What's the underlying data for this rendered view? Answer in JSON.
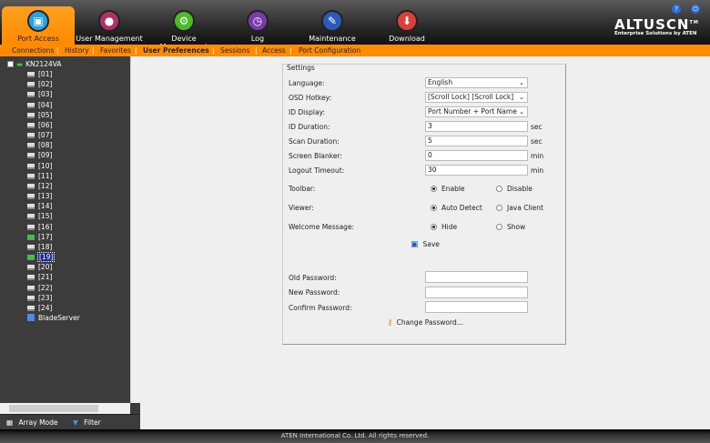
{
  "header": {
    "tabs": [
      {
        "label": "Port Access",
        "icon": "port-access-icon",
        "active": true
      },
      {
        "label": "User Management",
        "icon": "users-icon"
      },
      {
        "label": "Device Management",
        "icon": "device-icon"
      },
      {
        "label": "Log",
        "icon": "log-icon"
      },
      {
        "label": "Maintenance",
        "icon": "maintenance-icon"
      },
      {
        "label": "Download",
        "icon": "download-icon"
      }
    ],
    "logo": "ALTUSCN",
    "logo_tm": "TM",
    "logo_sub": "Enterprise Solutions by ATEN",
    "accent": "#ff8c00"
  },
  "subnav": {
    "items": [
      "Connections",
      "History",
      "Favorites",
      "User Preferences",
      "Sessions",
      "Access",
      "Port Configuration"
    ],
    "active": "User Preferences"
  },
  "sidebar": {
    "root": "KN2124VA",
    "ports": [
      "[01]",
      "[02]",
      "[03]",
      "[04]",
      "[05]",
      "[06]",
      "[07]",
      "[08]",
      "[09]",
      "[10]",
      "[11]",
      "[12]",
      "[13]",
      "[14]",
      "[15]",
      "[16]",
      "[17]",
      "[18]",
      "[19]",
      "[20]",
      "[21]",
      "[22]",
      "[23]",
      "[24]"
    ],
    "online": [
      "[17]",
      "[19]"
    ],
    "selected": "[19]",
    "blade": "BladeServer",
    "array_mode": "Array Mode",
    "filter": "Filter"
  },
  "settings": {
    "legend": "Settings",
    "language": {
      "label": "Language:",
      "value": "English"
    },
    "hotkey": {
      "label": "OSD Hotkey:",
      "value": "[Scroll Lock] [Scroll Lock]"
    },
    "id_display": {
      "label": "ID Display:",
      "value": "Port Number + Port Name"
    },
    "id_duration": {
      "label": "ID Duration:",
      "value": "3",
      "unit": "sec"
    },
    "scan_duration": {
      "label": "Scan Duration:",
      "value": "5",
      "unit": "sec"
    },
    "screen_blanker": {
      "label": "Screen Blanker:",
      "value": "0",
      "unit": "min"
    },
    "logout_timeout": {
      "label": "Logout Timeout:",
      "value": "30",
      "unit": "min"
    },
    "toolbar": {
      "label": "Toolbar:",
      "opt1": "Enable",
      "opt2": "Disable",
      "selected": "Enable"
    },
    "viewer": {
      "label": "Viewer:",
      "opt1": "Auto Detect",
      "opt2": "Java Client",
      "selected": "Auto Detect"
    },
    "welcome": {
      "label": "Welcome Message:",
      "opt1": "Hide",
      "opt2": "Show",
      "selected": "Hide"
    },
    "save": "Save",
    "old_pw": "Old Password:",
    "new_pw": "New Password:",
    "confirm_pw": "Confirm Password:",
    "change_pw": "Change Password..."
  },
  "footer": "ATEN International Co. Ltd. All rights reserved."
}
